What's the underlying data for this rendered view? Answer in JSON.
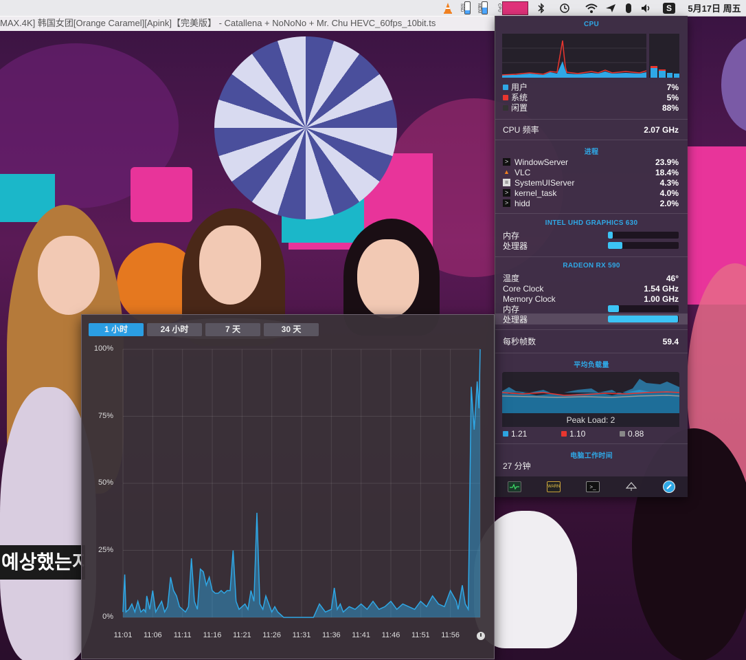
{
  "video": {
    "title": "MAX.4K] 韩国女团[Orange Caramel][Apink]【完美版】 - Catallena + NoNoNo + Mr. Chu HEVC_60fps_10bit.ts",
    "subtitle_text": "예상했는지"
  },
  "menubar": {
    "ssd_label": "SSD",
    "mem_label": "MEM",
    "cpu_label": "CPU",
    "date_time": "5月17日 周五"
  },
  "cpu": {
    "title": "CPU",
    "user_label": "用户",
    "user_value": "7%",
    "system_label": "系统",
    "system_value": "5%",
    "idle_label": "闲置",
    "idle_value": "88%",
    "freq_label": "CPU 频率",
    "freq_value": "2.07 GHz",
    "colors": {
      "user": "#2fa8e6",
      "system": "#e8362f",
      "idle": "#333333"
    }
  },
  "processes": {
    "title": "进程",
    "items": [
      {
        "name": "WindowServer",
        "value": "23.9%",
        "icon": "terminal-icon"
      },
      {
        "name": "VLC",
        "value": "18.4%",
        "icon": "vlc-cone-icon"
      },
      {
        "name": "SystemUIServer",
        "value": "4.3%",
        "icon": "document-icon"
      },
      {
        "name": "kernel_task",
        "value": "4.0%",
        "icon": "terminal-icon"
      },
      {
        "name": "hidd",
        "value": "2.0%",
        "icon": "terminal-icon"
      }
    ]
  },
  "intel_gpu": {
    "title": "INTEL UHD GRAPHICS 630",
    "memory_label": "内存",
    "memory_level": 0.07,
    "processor_label": "处理器",
    "processor_level": 0.2
  },
  "radeon_gpu": {
    "title": "RADEON RX 590",
    "temp_label": "温度",
    "temp_value": "46°",
    "core_label": "Core Clock",
    "core_value": "1.54 GHz",
    "mem_clock_label": "Memory Clock",
    "mem_clock_value": "1.00 GHz",
    "memory_label": "内存",
    "memory_level": 0.16,
    "processor_label": "处理器",
    "processor_level": 0.99
  },
  "fps": {
    "label": "每秒帧数",
    "value": "59.4"
  },
  "load": {
    "title": "平均负载量",
    "peak_text": "Peak Load: 2",
    "values": [
      "1.21",
      "1.10",
      "0.88"
    ],
    "colors": [
      "#2fa8e6",
      "#e8362f",
      "#888888"
    ]
  },
  "uptime": {
    "title": "电脑工作时间",
    "value": "27 分钟"
  },
  "toolbar_icons": [
    "activity-monitor-icon",
    "console-icon",
    "terminal-icon",
    "network-icon",
    "istat-icon"
  ],
  "history": {
    "tabs": [
      "1 小时",
      "24 小时",
      "7 天",
      "30 天"
    ],
    "active_tab": 0
  },
  "chart_data": {
    "type": "area",
    "y_ticks": [
      "100%",
      "75%",
      "50%",
      "25%",
      "0%"
    ],
    "ylim": [
      0,
      100
    ],
    "x_ticks": [
      "11:01",
      "11:06",
      "11:11",
      "11:16",
      "11:21",
      "11:26",
      "11:31",
      "11:36",
      "11:41",
      "11:46",
      "11:51",
      "11:56"
    ],
    "series": [
      {
        "color": "#2fa8e6",
        "x": [
          0,
          0.3,
          0.5,
          1,
          1.5,
          2,
          2.5,
          3,
          3.5,
          3.8,
          4,
          4.5,
          5,
          5.5,
          6,
          6.5,
          7,
          7.5,
          8,
          8.5,
          9,
          9.5,
          10,
          10.5,
          11,
          11.5,
          12,
          12.5,
          13,
          13.5,
          14,
          14.5,
          15,
          15.5,
          16,
          16.5,
          17,
          17.5,
          18,
          18.5,
          19,
          19.5,
          20,
          20.5,
          21,
          21.5,
          22,
          22.5,
          23,
          23.5,
          24,
          24.5,
          25,
          25.5,
          26,
          26.5,
          27,
          27.5,
          28,
          28.5,
          29,
          29.5,
          30,
          31,
          32,
          33,
          34,
          35,
          35.5,
          36,
          36.5,
          37,
          38,
          39,
          40,
          41,
          42,
          43,
          44,
          45,
          46,
          47,
          48,
          49,
          50,
          51,
          52,
          53,
          54,
          55,
          56,
          56.3,
          57,
          57.5,
          58,
          58.5,
          59,
          59.5,
          59.8,
          60
        ],
        "values": [
          2,
          16,
          2,
          3,
          5,
          2,
          6,
          2,
          3,
          2,
          8,
          3,
          10,
          2,
          4,
          6,
          2,
          4,
          15,
          10,
          8,
          4,
          3,
          2,
          4,
          22,
          6,
          3,
          18,
          17,
          12,
          15,
          10,
          9,
          9,
          10,
          9,
          10,
          10,
          25,
          6,
          3,
          4,
          5,
          3,
          10,
          6,
          39,
          5,
          3,
          8,
          5,
          2,
          4,
          2,
          1,
          0,
          0,
          0,
          0,
          0,
          0,
          0,
          0,
          0,
          5,
          2,
          3,
          11,
          3,
          5,
          2,
          4,
          3,
          5,
          3,
          6,
          3,
          4,
          6,
          3,
          5,
          4,
          3,
          6,
          4,
          8,
          5,
          4,
          10,
          6,
          3,
          12,
          5,
          3,
          86,
          70,
          88,
          78,
          100
        ]
      }
    ]
  }
}
